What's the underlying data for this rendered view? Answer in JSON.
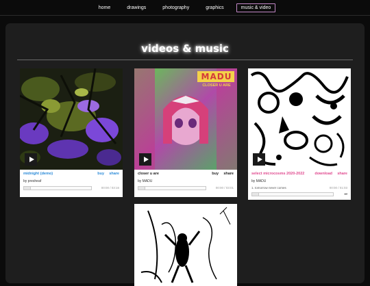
{
  "nav": {
    "items": [
      "home",
      "drawings",
      "photography",
      "graphics",
      "music & video"
    ],
    "active_index": 4,
    "active_border_color": "#c489c8"
  },
  "heading": "videos & music",
  "cards": [
    {
      "title": "midnight (demo)",
      "title_color": "#2a8ad8",
      "buy": "buy",
      "share": "share",
      "action_color": "#2a8ad8",
      "by": "by presheaf",
      "time": "00:00 / 03:16"
    },
    {
      "title": "closer u are",
      "title_color": "#222222",
      "buy": "buy",
      "share": "share",
      "action_color": "#222222",
      "by": "by MADU",
      "time": "00:00 / 03:01",
      "art_text": {
        "brand": "MADU",
        "subtitle": "CLOSER U ARE"
      }
    },
    {
      "title": "select microcosms 2020-2022",
      "title_color": "#e0488e",
      "download": "download",
      "share": "share",
      "action_color": "#e0488e",
      "by": "by MADU",
      "track": "1.  tomorrow never comes",
      "time": "00:00 / 01:03",
      "skip": "⏭"
    }
  ],
  "icons": [
    "play-icon",
    "skip-next-icon"
  ]
}
